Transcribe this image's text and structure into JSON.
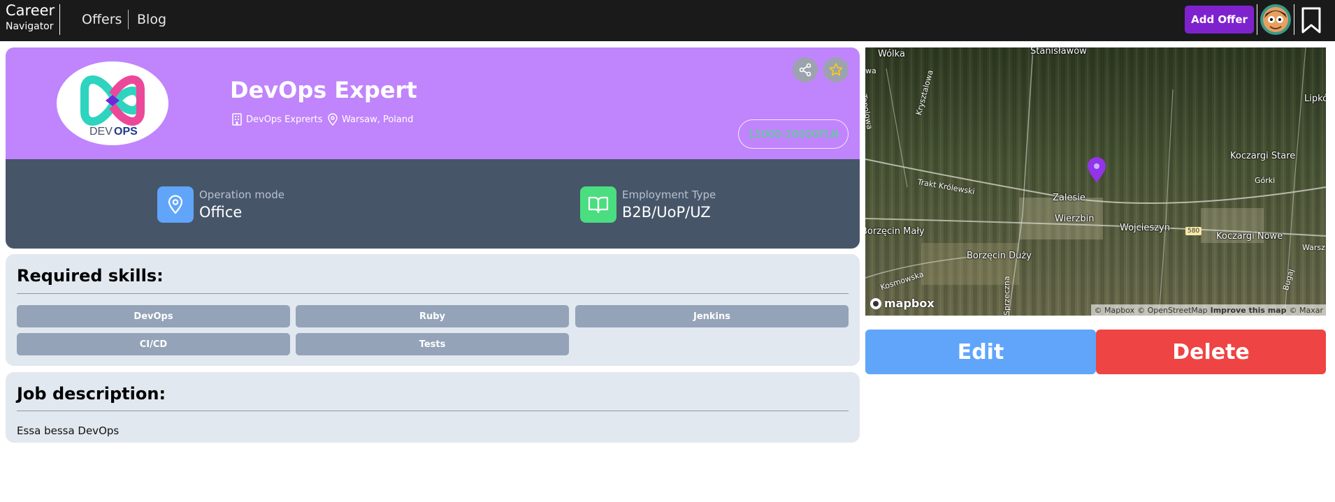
{
  "navbar": {
    "brand_line1": "Career",
    "brand_line2": "Navigator",
    "links": [
      "Offers",
      "Blog"
    ],
    "add_offer_label": "Add Offer"
  },
  "offer": {
    "title": "DevOps Expert",
    "company": "DevOps Exprerts",
    "location": "Warsaw, Poland",
    "salary": "15000-20000PLN",
    "logo_text_light": "DEV",
    "logo_text_bold": "OPS",
    "operation_mode_label": "Operation mode",
    "operation_mode_value": "Office",
    "employment_type_label": "Employment Type",
    "employment_type_value": "B2B/UoP/UZ"
  },
  "skills": {
    "title": "Required skills:",
    "items": [
      "DevOps",
      "Ruby",
      "Jenkins",
      "CI/CD",
      "Tests"
    ]
  },
  "description": {
    "title": "Job description:",
    "text": "Essa bessa DevOps"
  },
  "map": {
    "labels": [
      "Wólka",
      "Stanisławów",
      "Lipków",
      "Koczargi Stare",
      "Górki",
      "Zalesie",
      "Wierzbin",
      "Wojcieszyn",
      "Koczargi Nowe",
      "Borzęcin Mały",
      "Borzęcin Duży",
      "Warsz",
      "wa"
    ],
    "road_labels": [
      "Topolowa",
      "Krysztalowa",
      "Trakt Królewski",
      "Kosmowska",
      "Sprzeczna",
      "Bugaj"
    ],
    "route_number": "580",
    "logo_text": "mapbox",
    "attribution": [
      "© Mapbox",
      "© OpenStreetMap",
      "Improve this map",
      "© Maxar"
    ]
  },
  "actions": {
    "edit_label": "Edit",
    "delete_label": "Delete"
  },
  "colors": {
    "navbar_bg": "#1a1a1a",
    "accent_purple": "#7e22ce",
    "hero_bg": "#c084fc",
    "info_bar_bg": "#475569",
    "card_bg": "#e2e8f0",
    "skill_chip": "#94a3b8",
    "salary_text": "#4ade80",
    "edit_button": "#60a5fa",
    "delete_button": "#ef4444",
    "map_pin": "#9333ea"
  },
  "icons": [
    "building-icon",
    "map-pin-icon",
    "share-icon",
    "star-icon",
    "book-open-icon",
    "bookmark-icon",
    "avatar"
  ]
}
